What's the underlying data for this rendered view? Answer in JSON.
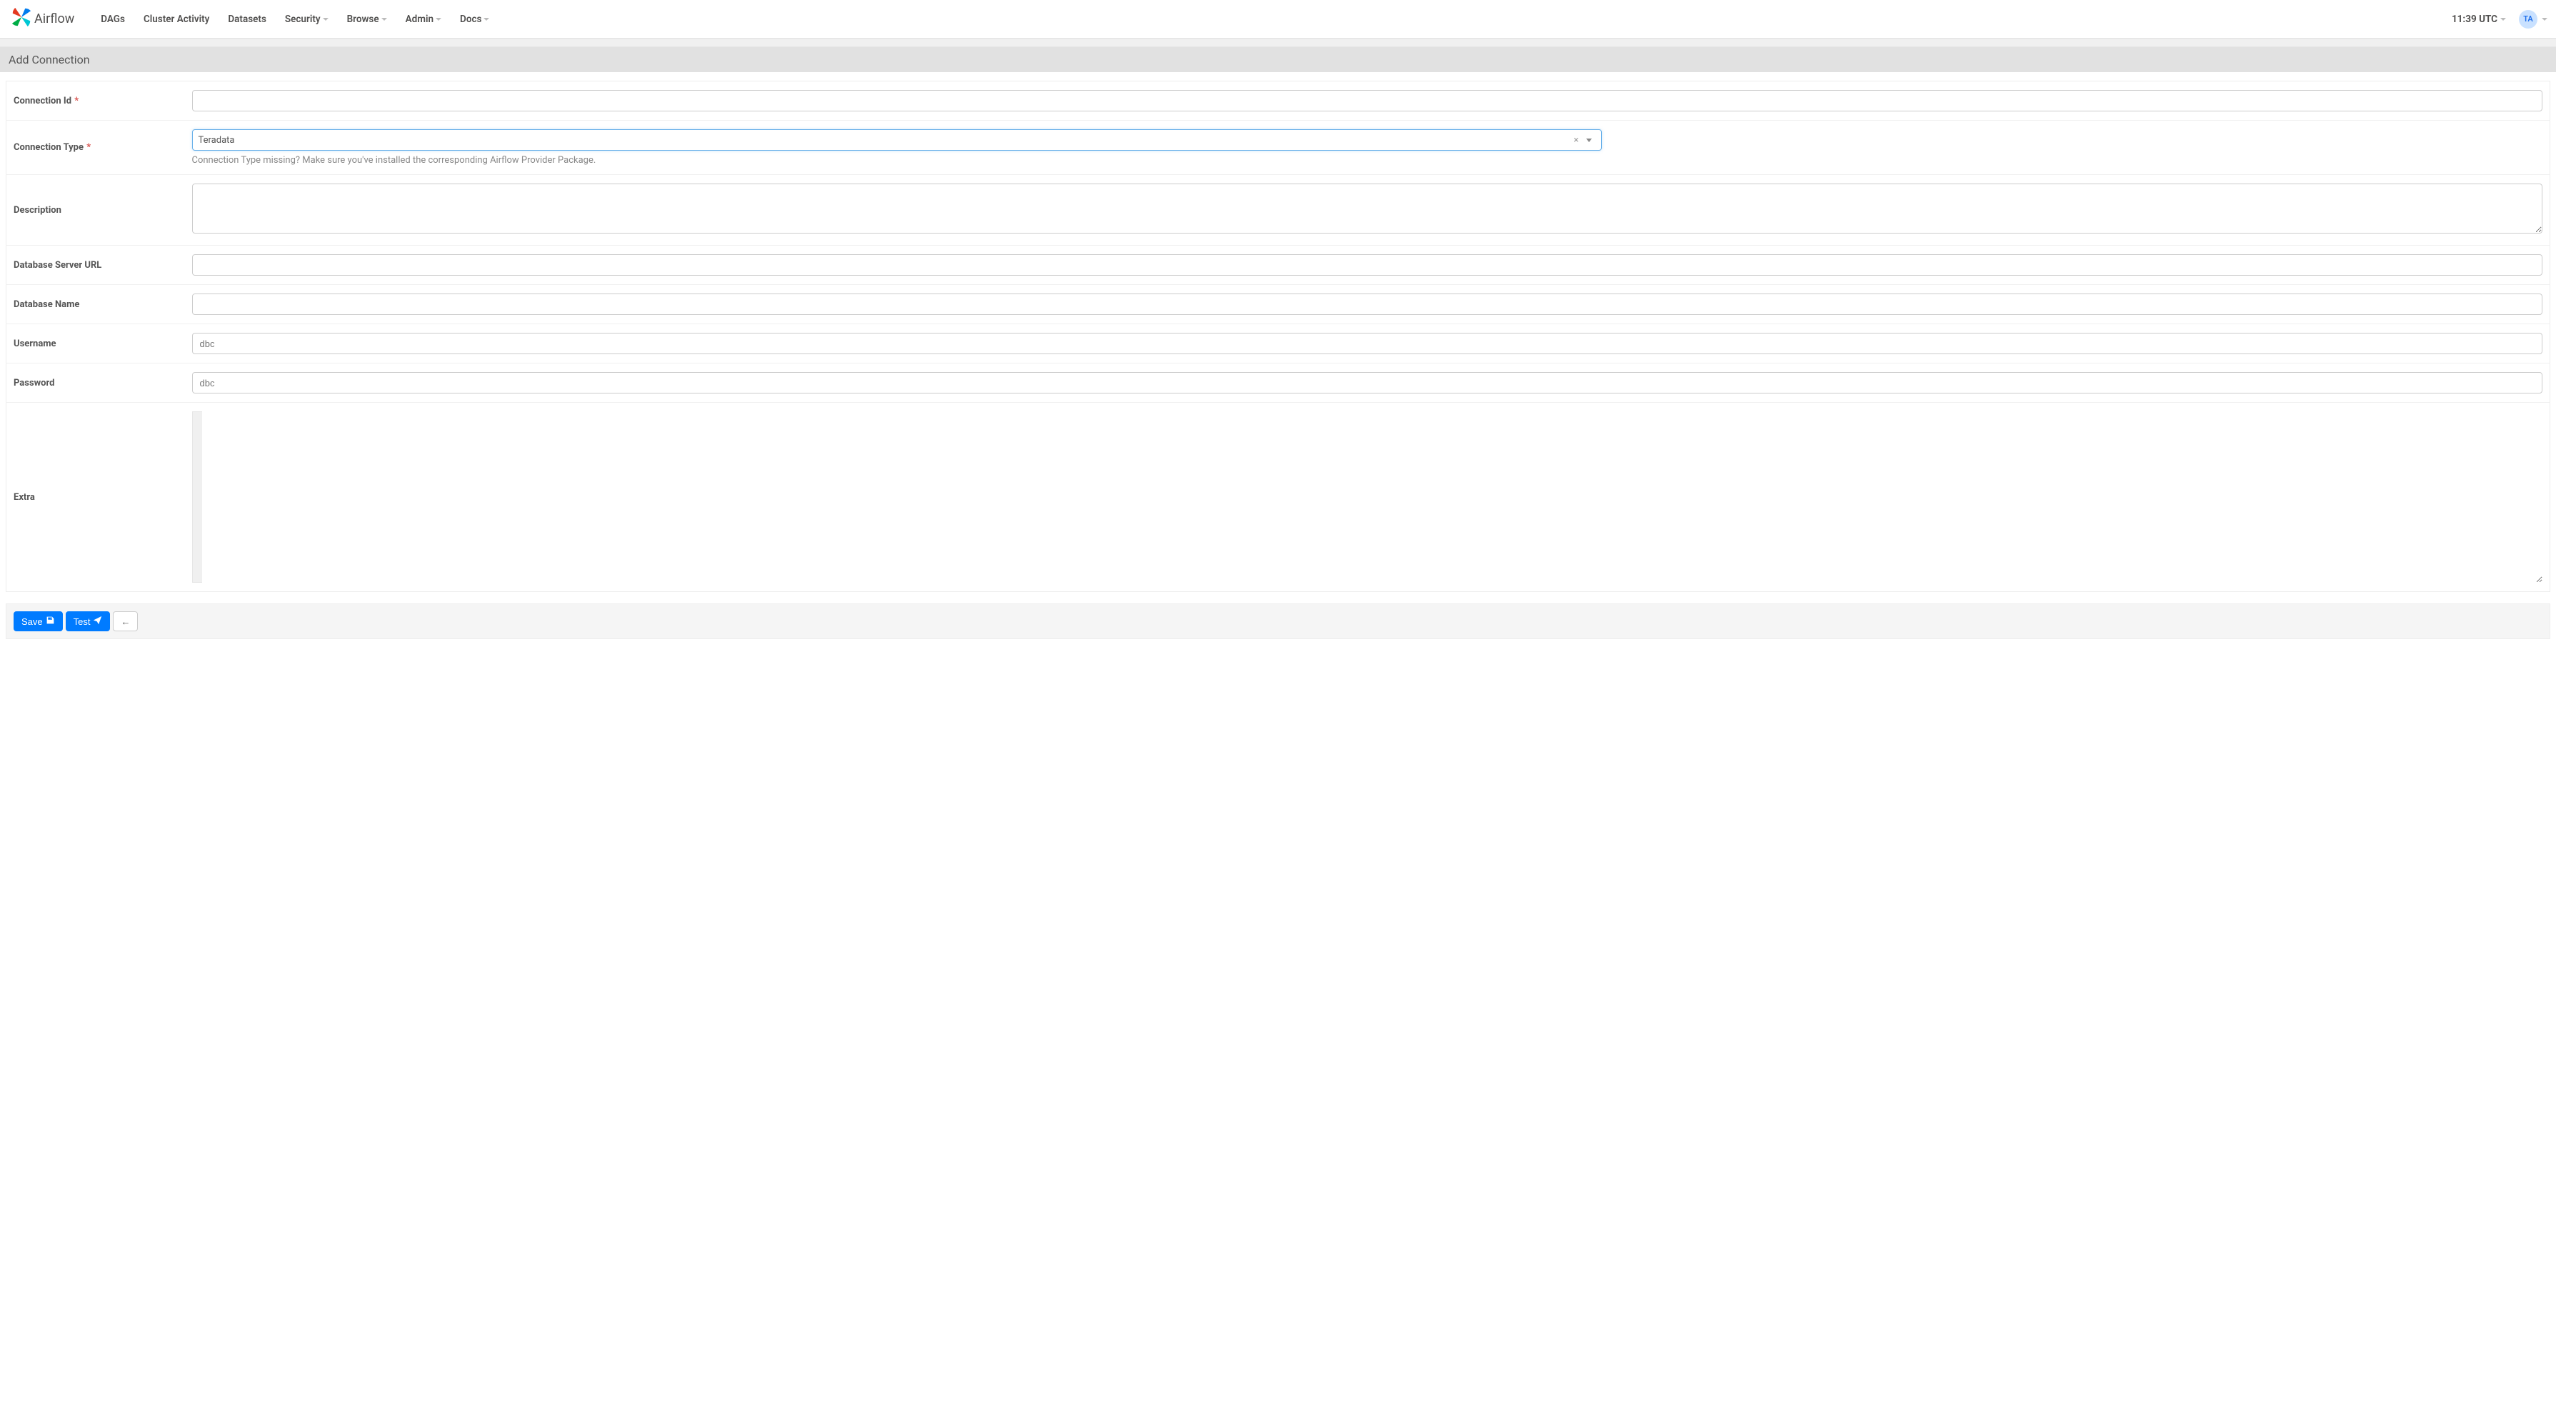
{
  "brand": "Airflow",
  "nav": [
    {
      "label": "DAGs",
      "caret": false
    },
    {
      "label": "Cluster Activity",
      "caret": false
    },
    {
      "label": "Datasets",
      "caret": false
    },
    {
      "label": "Security",
      "caret": true
    },
    {
      "label": "Browse",
      "caret": true
    },
    {
      "label": "Admin",
      "caret": true
    },
    {
      "label": "Docs",
      "caret": true
    }
  ],
  "clock": "11:39 UTC",
  "avatar_initials": "TA",
  "page_title": "Add Connection",
  "form": {
    "conn_id": {
      "label": "Connection Id",
      "value": "",
      "required": true,
      "type": "text"
    },
    "conn_type": {
      "label": "Connection Type",
      "value": "Teradata",
      "required": true,
      "type": "select",
      "help": "Connection Type missing? Make sure you've installed the corresponding Airflow Provider Package."
    },
    "description": {
      "label": "Description",
      "value": "",
      "type": "textarea"
    },
    "db_server_url": {
      "label": "Database Server URL",
      "value": "",
      "type": "text"
    },
    "db_name": {
      "label": "Database Name",
      "value": "",
      "type": "text"
    },
    "username": {
      "label": "Username",
      "value": "",
      "type": "text",
      "placeholder": "dbc"
    },
    "password": {
      "label": "Password",
      "value": "",
      "type": "password",
      "placeholder": "dbc"
    },
    "extra": {
      "label": "Extra",
      "value": "",
      "type": "code"
    }
  },
  "toolbar": {
    "save_label": "Save",
    "test_label": "Test",
    "back_label": "←"
  }
}
